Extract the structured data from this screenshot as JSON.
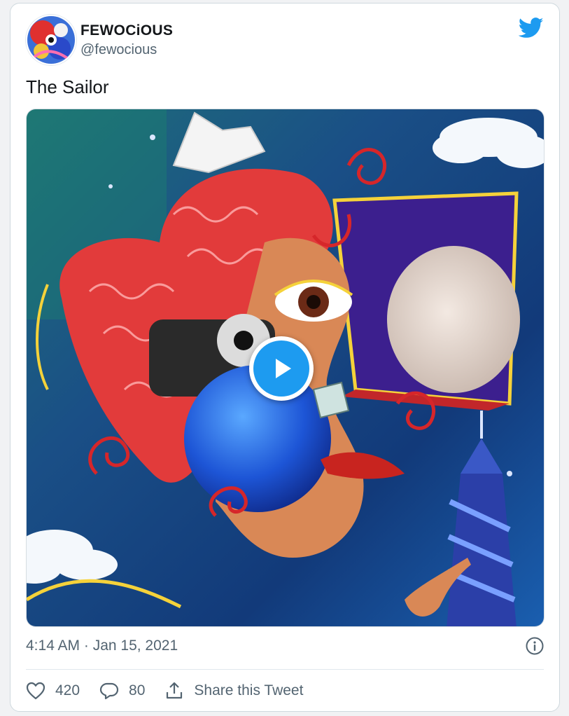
{
  "tweet": {
    "display_name": "FEWOCiOUS",
    "handle": "@fewocious",
    "text": "The Sailor",
    "timestamp": "4:14 AM · Jan 15, 2021",
    "likes": "420",
    "replies": "80",
    "share_label": "Share this Tweet"
  },
  "icons": {
    "brand": "twitter-bird-icon",
    "info": "info-icon",
    "like": "heart-icon",
    "reply": "reply-bubble-icon",
    "share": "share-icon",
    "play": "play-icon"
  },
  "colors": {
    "twitter_blue": "#1d9bf0",
    "secondary_text": "#536471",
    "primary_text": "#14171a"
  }
}
